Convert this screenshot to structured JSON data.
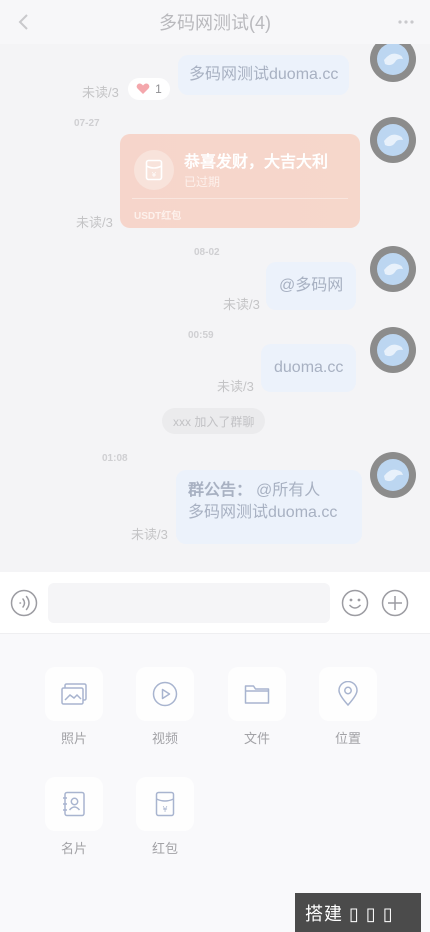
{
  "header": {
    "title": "多码网测试(4)",
    "back_icon": "chevron-left-icon",
    "more_icon": "more-dots-icon"
  },
  "messages": [
    {
      "text": "多码网测试duoma.cc",
      "unread": "未读/3",
      "like_count": "1"
    },
    {
      "time": "07-27",
      "type": "redpacket",
      "title": "恭喜发财，大吉大利",
      "status": "已过期",
      "kind": "USDT红包",
      "unread": "未读/3"
    },
    {
      "time": "08-02",
      "text": "@多码网",
      "unread": "未读/3"
    },
    {
      "time": "00:59",
      "text": "duoma.cc",
      "unread": "未读/3"
    },
    {
      "system": "xxx 加入了群聊"
    },
    {
      "time": "01:08",
      "notice_label": "群公告：",
      "notice_mention": "@所有人",
      "notice_text": "多码网测试duoma.cc",
      "unread": "未读/3"
    }
  ],
  "input": {
    "placeholder": "",
    "voice_icon": "voice-icon",
    "emoji_icon": "emoji-icon",
    "plus_icon": "plus-circle-icon"
  },
  "tools": [
    {
      "label": "照片",
      "icon": "photo-icon"
    },
    {
      "label": "视频",
      "icon": "video-icon"
    },
    {
      "label": "文件",
      "icon": "folder-icon"
    },
    {
      "label": "位置",
      "icon": "location-icon"
    },
    {
      "label": "名片",
      "icon": "contact-card-icon"
    },
    {
      "label": "红包",
      "icon": "red-packet-icon"
    }
  ],
  "watermark": "搭建 ▯ ▯ ▯",
  "colors": {
    "bubble": "#ecf2fb",
    "redpacket": "#f6d5cb",
    "icon": "#a8b4cf"
  }
}
